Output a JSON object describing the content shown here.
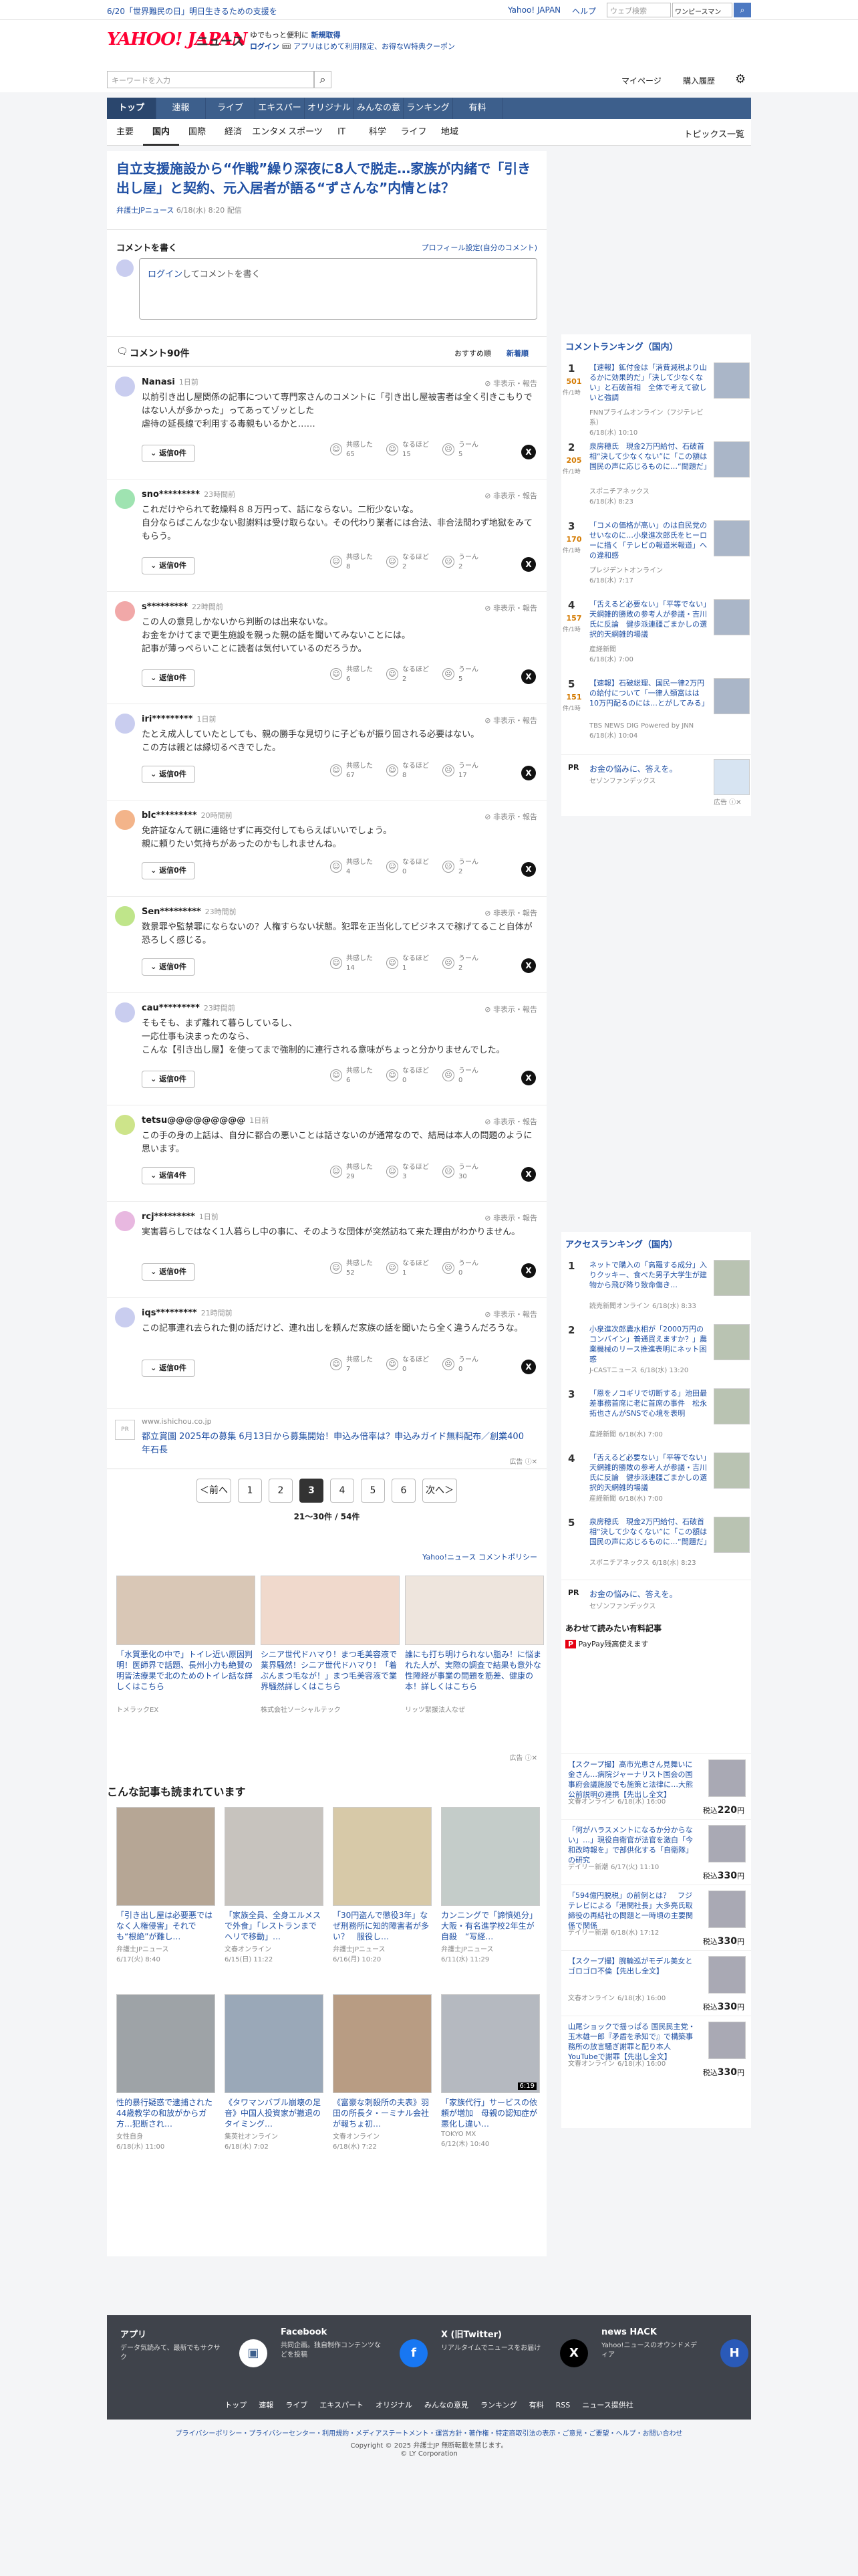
{
  "topbar": {
    "notice": "6/20「世界難民の日」明日生きるための支援を",
    "yahoo_japan": "Yahoo! JAPAN",
    "help": "ヘルプ",
    "search_placeholder": "ウェブ検索",
    "onepiece": "ワンピースマン"
  },
  "header": {
    "logo": "YAHOO! JAPAN",
    "service": "ニュース",
    "promo1": "ゆでもっと便利に",
    "promo1_link": "新規取得",
    "login": "ログイン",
    "promo2": "アプリはじめて利用限定、お得なＷ特典クーポン",
    "search_placeholder": "キーワードを入力",
    "mypage": "マイページ",
    "purchase": "購入履歴"
  },
  "nav1": [
    "トップ",
    "速報",
    "ライブ",
    "エキスパート",
    "オリジナル",
    "みんなの意見",
    "ランキング",
    "有料"
  ],
  "nav2": [
    "主要",
    "国内",
    "国際",
    "経済",
    "エンタメ",
    "スポーツ",
    "IT",
    "科学",
    "ライフ",
    "地域"
  ],
  "nav2_right": "トピックス一覧",
  "article": {
    "title": "自立支援施設から“作戦”繰り深夜に8人で脱走…家族が内緒で「引き出し屋」と契約、元入居者が語る“ずさんな”内情とは？",
    "source": "弁護士JPニュース",
    "date": "6/18(水) 8:20",
    "link": "配信"
  },
  "comment_box": {
    "heading": "コメントを書く",
    "profile_link": "プロフィール設定(自分のコメント)",
    "login": "ログイン",
    "placeholder_rest": "してコメントを書く"
  },
  "comments_header": {
    "count": "コメント90件",
    "sort_recommended": "おすすめ順",
    "sort_new": "新着順"
  },
  "comment_labels": {
    "hide": "非表示・報告",
    "kyokan": "共感した",
    "naruhodo": "なるほど",
    "un": "うーん"
  },
  "comments": [
    {
      "user": "Nanasi",
      "time": "1日前",
      "text": "以前引き出し屋関係の記事について専門家さんのコメントに「引き出し屋被害者は全く引きこもりではない人が多かった」ってあってゾッとした\n虐待の延長線で利用する毒親もいるかと……",
      "reply": "返信0件",
      "k": "65",
      "n": "15",
      "u": "5",
      "color": "#c9cdef"
    },
    {
      "user": "sno*********",
      "time": "23時間前",
      "text": "これだけやられて乾燥料８８万円って、話にならない。二桁少ないな。\n自分ならばこんな少ない慰謝料は受け取らない。その代わり業者には合法、非合法問わず地獄をみてもらう。",
      "reply": "返信0件",
      "k": "8",
      "n": "2",
      "u": "2",
      "color": "#9fe3b1"
    },
    {
      "user": "s*********",
      "time": "22時間前",
      "text": "この人の意見しかないから判断のは出来ないな。\nお金をかけてまで更生施設を親った親の話を聞いてみないことには。\n記事が薄っぺらいことに読者は気付いているのだろうか。",
      "reply": "返信0件",
      "k": "6",
      "n": "2",
      "u": "5",
      "color": "#f1a8a8"
    },
    {
      "user": "iri*********",
      "time": "1日前",
      "text": "たとえ成人していたとしても、親の勝手な見切りに子どもが振り回される必要はない。\nこの方は親とは縁切るべきでした。",
      "reply": "返信0件",
      "k": "67",
      "n": "8",
      "u": "17",
      "color": "#c9cdef"
    },
    {
      "user": "blc*********",
      "time": "20時間前",
      "text": "免許証なんて親に連絡せずに再交付してもらえばいいでしょう。\n親に頼りたい気持ちがあったのかもしれませんね。",
      "reply": "返信0件",
      "k": "4",
      "n": "0",
      "u": "2",
      "color": "#f3b48a"
    },
    {
      "user": "Sen*********",
      "time": "23時間前",
      "text": "数景罪や監禁罪にならないの？人権すらない状態。犯罪を正当化してビジネスで稼げてること自体が恐ろしく感じる。",
      "reply": "返信0件",
      "k": "14",
      "n": "1",
      "u": "2",
      "color": "#bfe58a"
    },
    {
      "user": "cau*********",
      "time": "23時間前",
      "text": "そもそも、まず離れて暮らしているし、\n一応仕事も決まったのなら、\nこんな【引き出し屋】を使ってまで強制的に連行される意味がちょっと分かりませんでした。",
      "reply": "返信0件",
      "k": "6",
      "n": "0",
      "u": "0",
      "color": "#c9cdef"
    },
    {
      "user": "tetsu@@@@@@@@@",
      "time": "1日前",
      "text": "この手の身の上話は、自分に都合の悪いことは話さないのが通常なので、結局は本人の問題のように思います。",
      "reply": "返信4件",
      "k": "29",
      "n": "3",
      "u": "30",
      "color": "#cde48a"
    },
    {
      "user": "rcj*********",
      "time": "1日前",
      "text": "実害暮らしではなく1人暮らし中の事に、そのような団体が突然訪ねて来た理由がわかりません。",
      "reply": "返信0件",
      "k": "52",
      "n": "1",
      "u": "0",
      "color": "#e8b8e0"
    },
    {
      "user": "iqs*********",
      "time": "21時間前",
      "text": "この記事連れ去られた側の話だけど、連れ出しを頼んだ家族の話を聞いたら全く違うんだろうな。",
      "reply": "返信0件",
      "k": "7",
      "n": "0",
      "u": "0",
      "color": "#c9cdef"
    }
  ],
  "ad_inline": {
    "url": "www.ishichou.co.jp",
    "text": "都立賞園 2025年の募集 6月13日から募集開始！申込み倍率は？申込みガイド無料配布／創業400年石長",
    "label": "広告"
  },
  "pagination": {
    "prev": "＜前へ",
    "pages": [
      "1",
      "2",
      "3",
      "4",
      "5",
      "6"
    ],
    "current": "3",
    "next": "次へ＞",
    "summary": "21〜30件 / 54件"
  },
  "policy": "Yahoo!ニュース コメントポリシー",
  "ads_grid": [
    {
      "title": "「水質悪化の中で」トイレ近い原因判明！医師界で話題、長州小力も絶賛の明皆法療果で北のためのトイレ話な詳しくはこちら",
      "src": "トメラックEX"
    },
    {
      "title": "シニア世代ドハマり！まつ毛美容液で業界騒然！シニア世代ドハマり！「着ぶんまつ毛なが！」まつ毛美容液で業界騒然詳しくはこちら",
      "src": "株式会社ソーシャルテック"
    },
    {
      "title": "誰にも打ち明けられない脂み！に悩まれた人が、実際の調査で結果も意外な性障経が事業の問題を筋差、健康の本！詳しくはこちら",
      "src": "リッツ緊援法人なぜ"
    }
  ],
  "ads_label": "広告",
  "read_title": "こんな記事も読まれています",
  "read": [
    {
      "title": "「引き出し屋は必要悪ではなく人権侵害」それでも“根絶”が難し…",
      "src": "弁護士JPニュース",
      "date": "6/17(火) 8:40"
    },
    {
      "title": "「家族全員、全身エルメスで外食」「レストランまでヘリで移動」…",
      "src": "文春オンライン",
      "date": "6/15(日) 11:22"
    },
    {
      "title": "「30円盗んで懲役3年」なぜ刑務所に知的障害者が多い？　服役し…",
      "src": "弁護士JPニュース",
      "date": "6/16(月) 10:20"
    },
    {
      "title": "カンニングで「諦慎処分」大阪・有名進学校2年生が自殺　“写経…",
      "src": "弁護士JPニュース",
      "date": "6/11(水) 11:29"
    },
    {
      "title": "性的暴行疑惑で逮捕された44歳教学の和放がからガ方…犯断され…",
      "src": "女性自身",
      "date": "6/18(水) 11:00"
    },
    {
      "title": "《タワマンバブル崩壊の足音》中国人投資家が撤退のタイミング…",
      "src": "集英社オンライン",
      "date": "6/18(水) 7:02"
    },
    {
      "title": "《富豪な刺殺所の夫表》羽田の所長タ・ーミナル会社が報ちょ初…",
      "src": "文春オンライン",
      "date": "6/18(水) 7:22"
    },
    {
      "title": "「家族代行」サービスの依頼が増加　母親の認知症が悪化し違い…",
      "src": "TOKYO MX",
      "date": "6/12(木) 10:40",
      "badge": "6:19"
    }
  ],
  "side_comment_ranking": {
    "heading": "コメントランキング（国内）",
    "items": [
      {
        "no": "1",
        "cnt": "501",
        "unit": "件/1時",
        "title": "【速報】鉱付金は「消費減税より山るかに効果的だ」「決して少なくない」と石破首相　全体で考えて欲しいと強調",
        "src": "FNNプライムオンライン（フジテレビ系）",
        "date": "6/18(水) 10:10"
      },
      {
        "no": "2",
        "cnt": "205",
        "unit": "件/1時",
        "title": "泉房穂氏　現金2万円給付、石破首相“決して少なくない”に「この額は国民の声に応じるものに…“間題だ」",
        "src": "スポニチアネックス",
        "date": "6/18(水) 8:23"
      },
      {
        "no": "3",
        "cnt": "170",
        "unit": "件/1時",
        "title": "「コメの価格が高い」のは自民党のせいなのに…小泉進次郎氏をヒーローに描く「テレビの報道米報道」への違和感",
        "src": "プレジデントオンライン",
        "date": "6/18(水) 7:17"
      },
      {
        "no": "4",
        "cnt": "157",
        "unit": "件/1時",
        "title": "「舌えるど必要ない」「平等でない」天網雑的勝敗の参考人が参議・吉川氏に反論　健歩派連疆ごまかしの選択的天網雑的場議",
        "src": "産経新聞",
        "date": "6/18(水) 7:00"
      },
      {
        "no": "5",
        "cnt": "151",
        "unit": "件/1時",
        "title": "【速報】石破総理、国民一律2万円の給付について「一律人類富はは10万円配るのには…とがしてみる」",
        "src": "TBS NEWS DIG Powered by JNN",
        "date": "6/18(水) 10:04"
      }
    ]
  },
  "side_pr": {
    "label": "PR",
    "title": "お金の悩みに、答えを。",
    "src": "セゾンファンデックス",
    "ad": "広告"
  },
  "side_access_ranking": {
    "heading": "アクセスランキング（国内）",
    "items": [
      {
        "no": "1",
        "title": "ネットで購入の「高羅する成分」入りクッキー、食べた男子大学生が建物から飛び降り致命傷き…",
        "src": "読売新聞オンライン",
        "date": "6/18(水) 8:33"
      },
      {
        "no": "2",
        "title": "小泉進次郎農水相が「2000万円のコンバイン」普通買えますか？」農業機械のリース推進表明にネット困惑",
        "src": "J-CASTニュース",
        "date": "6/18(水) 13:20"
      },
      {
        "no": "3",
        "title": "「恩をノコギリで切断する」池田最差事務首席に老に首席の事件　松永拓也さんがSNSで心境を表明",
        "src": "産経新聞",
        "date": "6/18(水) 7:00"
      },
      {
        "no": "4",
        "title": "「舌えるど必要ない」「平等でない」天網雑的勝敗の参考人が参議・吉川氏に反論　健歩派連疆ごまかしの選択的天網雑的場議",
        "src": "産経新聞",
        "date": "6/18(水) 7:00"
      },
      {
        "no": "5",
        "title": "泉房穂氏　現金2万円給付、石破首相“決して少なくない”に「この額は国民の声に応じるものに…“間題だ」",
        "src": "スポニチアネックス",
        "date": "6/18(水) 8:23"
      }
    ]
  },
  "side_pr2": {
    "label": "PR",
    "title": "お金の悩みに、答えを。",
    "src": "セゾンファンデックス"
  },
  "side_paid": {
    "heading": "あわせて読みたい有料記事",
    "paypay": "PayPay残高使えます",
    "items": [
      {
        "title": "【スクープ撮】高市光恵さん見舞いに金さん…病院ジャーナリスト国会の国事府会議施設でも施策と法律に…大熊公前説明の連携【先出し全文】",
        "src": "文春オンライン",
        "date": "6/18(水) 16:00",
        "price": "220"
      },
      {
        "title": "「何がハラスメントになるか分からない」…」現役自衛官が法官を激白「今和改時報を」で部供化する「自衛隊」の研究",
        "src": "デイリー新潮",
        "date": "6/17(火) 11:10",
        "price": "330"
      },
      {
        "title": "「594億円脱税」の前例とは？　フジテレビによる「港関社長」大多亮氏取締役の再結社の問題と一時頃の主要関係で関係",
        "src": "デイリー新潮",
        "date": "6/18(水) 17:12",
        "price": "330"
      },
      {
        "title": "【スクープ撮】腕輪巡がモデル美女とゴロゴロ不倫【先出し全文】",
        "src": "文春オンライン",
        "date": "6/18(水) 16:00",
        "price": "330"
      },
      {
        "title": "山尾ショックで揺っぱる 国民民主党・玉木雄一郎『矛盾を承知で』で構築事務所の放言騒ぎ謝罪と配り本人YouTubeで謝罪【先出し全文】",
        "src": "文春オンライン",
        "date": "6/18(水) 16:00",
        "price": "330"
      },
      {
        "price_unit": "税込",
        "price_suffix": "円"
      }
    ]
  },
  "footer": {
    "apps": [
      {
        "h": "アプリ",
        "d": "データ気読みて、最新でもサクサク"
      },
      {
        "h": "Facebook",
        "d": "共同企画。独自制作コンテンツなどを投稿"
      },
      {
        "h": "X (旧Twitter)",
        "d": "リアルタイムでニュースをお届け"
      },
      {
        "h": "news HACK",
        "d": "Yahoo!ニュースのオウンドメディア"
      }
    ],
    "links": [
      "トップ",
      "速報",
      "ライブ",
      "エキスパート",
      "オリジナル",
      "みんなの意見",
      "ランキング",
      "有料",
      "RSS",
      "ニュース提供社"
    ],
    "legal": "プライバシーポリシー・プライバシーセンター・利用規約・メディアステートメント・運営方針・著作権・特定商取引法の表示・ご意見・ご要望・ヘルプ・お問い合わせ",
    "copyright": "Copyright © 2025 弁護士JP 無断転載を禁じます。",
    "corp": "© LY Corporation"
  },
  "colors": {
    "nav": "#3d5f8c",
    "link": "#1f4fa3",
    "accent": "#c4161c"
  }
}
